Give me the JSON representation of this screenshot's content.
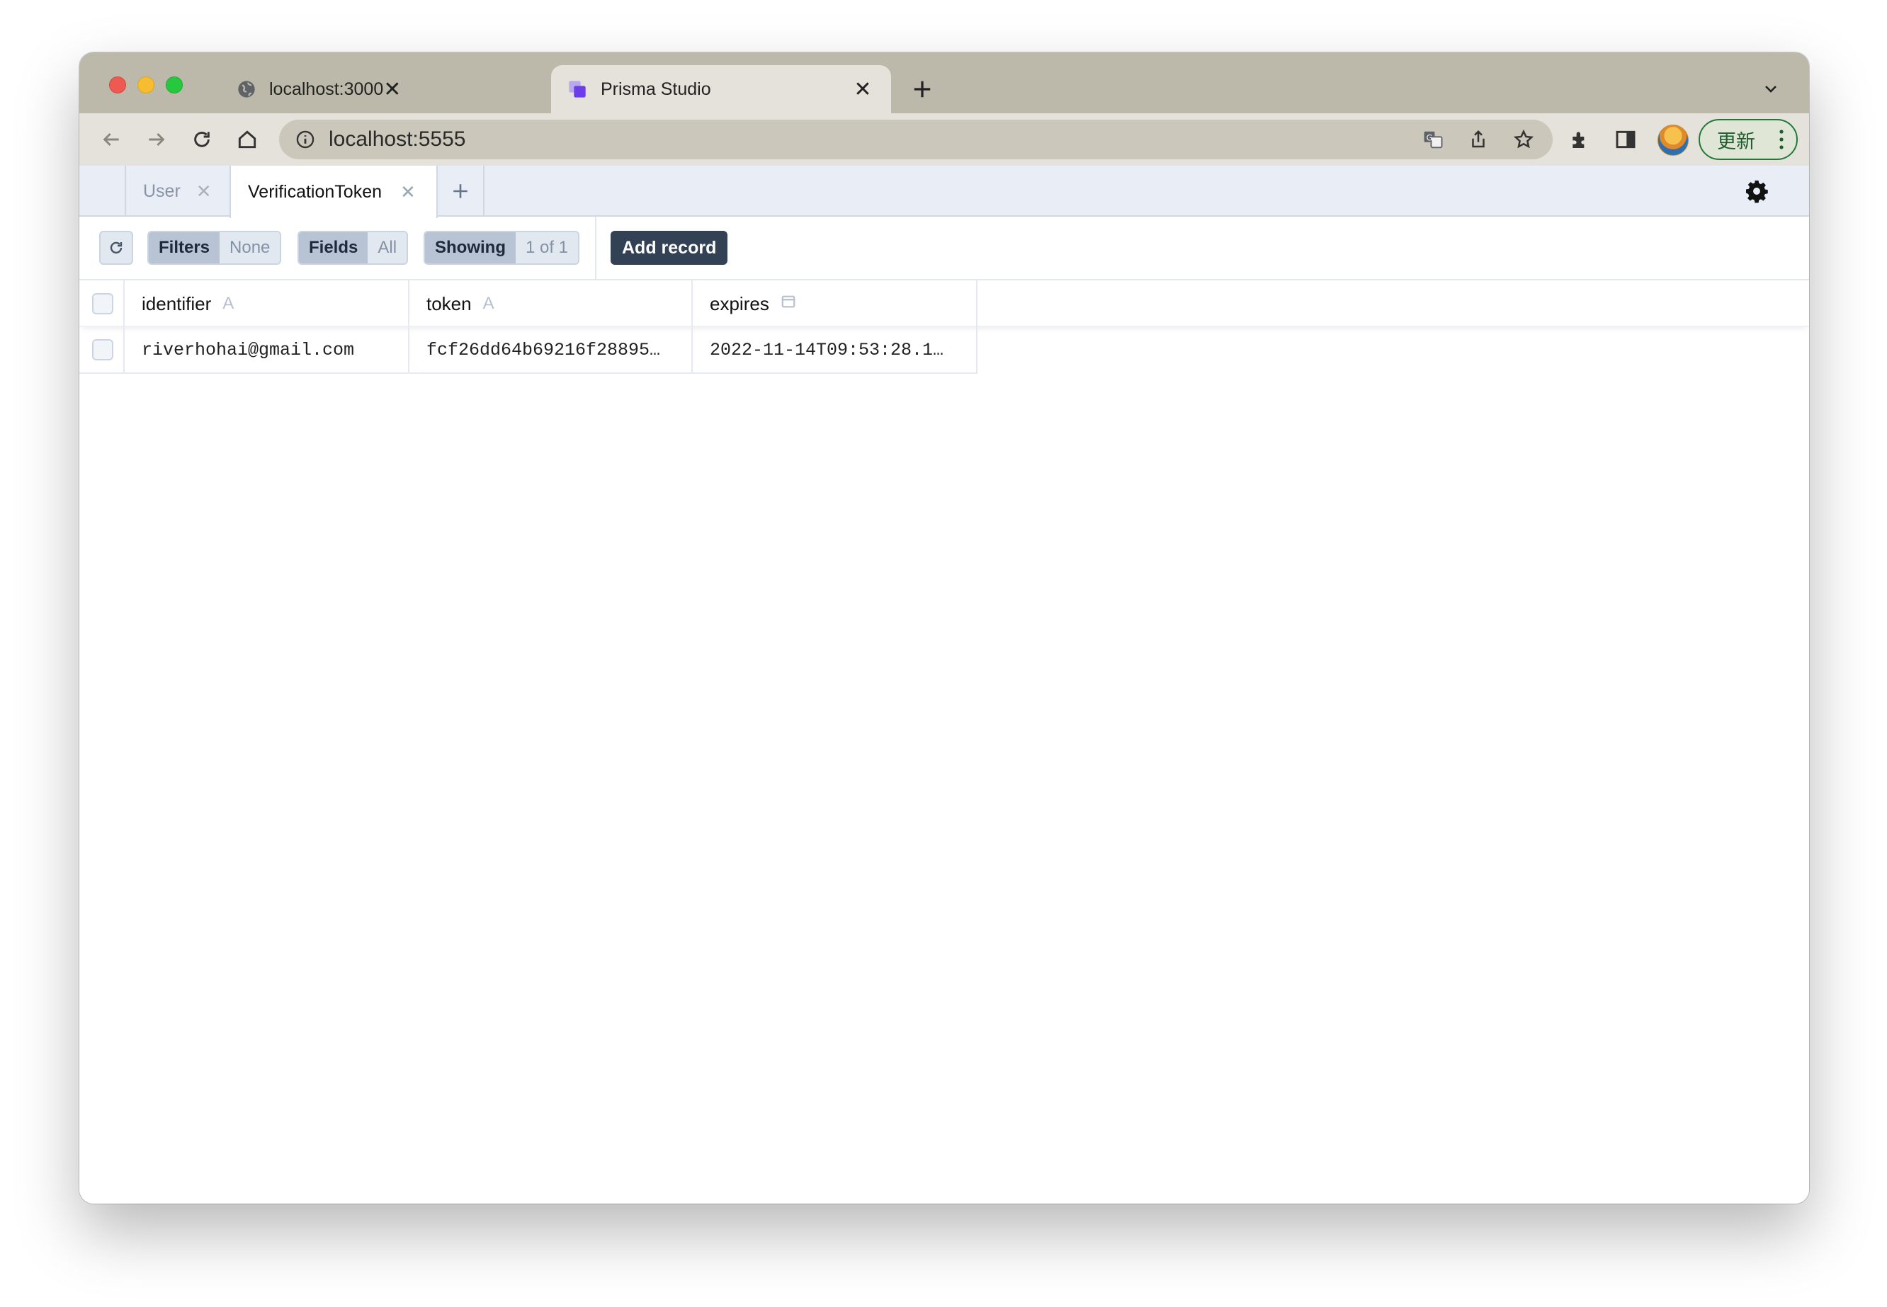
{
  "browser": {
    "tabs": [
      {
        "title": "localhost:3000",
        "favicon": "globe-icon"
      },
      {
        "title": "Prisma Studio",
        "favicon": "prisma-icon"
      }
    ],
    "url": "localhost:5555",
    "update_label": "更新"
  },
  "studio": {
    "model_tabs": [
      {
        "label": "User",
        "active": false
      },
      {
        "label": "VerificationToken",
        "active": true
      }
    ],
    "controls": {
      "filters_label": "Filters",
      "filters_value": "None",
      "fields_label": "Fields",
      "fields_value": "All",
      "showing_label": "Showing",
      "showing_value": "1 of 1",
      "add_record_label": "Add record"
    },
    "columns": [
      {
        "name": "identifier",
        "type_icon": "A"
      },
      {
        "name": "token",
        "type_icon": "A"
      },
      {
        "name": "expires",
        "type_icon": "calendar-icon"
      }
    ],
    "rows": [
      {
        "identifier": "riverhohai@gmail.com",
        "token": "fcf26dd64b69216f28895…",
        "expires": "2022-11-14T09:53:28.1…"
      }
    ]
  }
}
